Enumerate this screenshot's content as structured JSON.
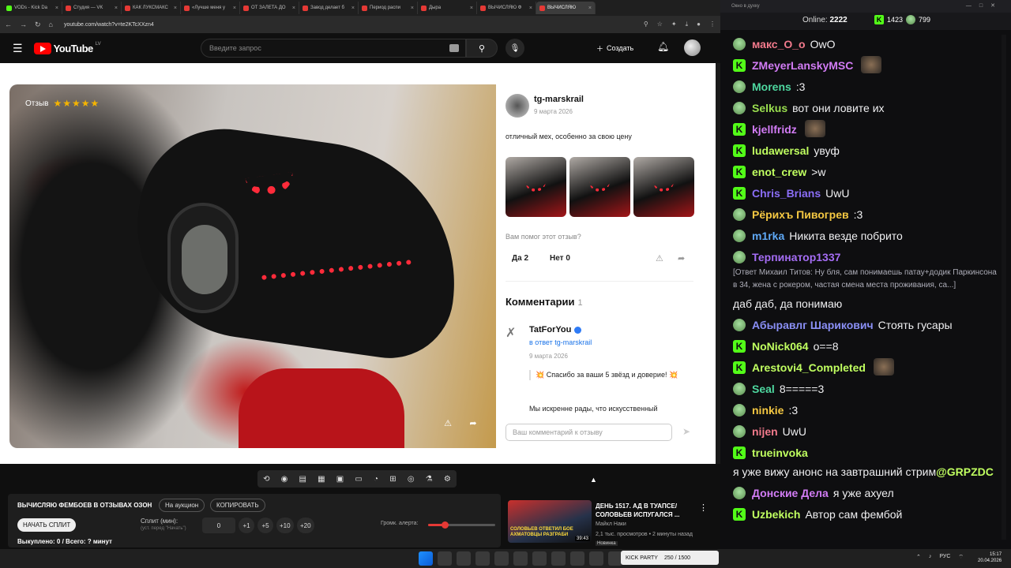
{
  "browser": {
    "tabs": [
      "VODs - Kick Da",
      "Студия — VK",
      "КАК ЛУКСМАКС",
      "«Лучше меня у",
      "ОТ ЗАЛЕТА ДО",
      "Завод делает б",
      "Период распи",
      "Дыра",
      "ВЫЧИСЛЯЮ Ф",
      "ВЫЧИСЛЯЮ"
    ],
    "url": "youtube.com/watch?v=te2KTcXXzn4",
    "window_controls": [
      "—",
      "□",
      "✕"
    ]
  },
  "youtube": {
    "logo_text": "YouTube",
    "country": "LV",
    "search_placeholder": "Введите запрос",
    "create_label": "Создать"
  },
  "review": {
    "badge_label": "Отзыв",
    "stars": "★★★★★",
    "author": "tg-marskrail",
    "date": "9 марта 2026",
    "text": "отличный мех, особенно за свою цену",
    "helpful_question": "Вам помог этот отзыв?",
    "yes_label": "Да 2",
    "no_label": "Нет 0",
    "comments_title": "Комментарии",
    "comments_count": "1",
    "comment": {
      "author": "TatForYou",
      "reply_to": "в ответ tg-marskrail",
      "date": "9 марта 2026",
      "line1": "💥 Спасибо за ваши 5 звёзд и доверие! 💥",
      "line2": "Мы искренне рады, что искусственный"
    },
    "comment_placeholder": "Ваш комментарий к отзыву"
  },
  "extension": {
    "title": "ВЫЧИСЛЯЮ ФЕМБОЕВ В ОТЗЫВАХ ОЗОН",
    "auction_label": "На аукцион",
    "copy_label": "КОПИРОВАТЬ",
    "start_label": "НАЧАТЬ СПЛИТ",
    "split_label": "Сплит (мин):",
    "split_hint": "(уст. перед \"Начать\")",
    "split_value": "0",
    "increments": [
      "+1",
      "+5",
      "+10",
      "+20"
    ],
    "volume_label": "Громк. алерта:",
    "volume_level": 0.25,
    "status": "Выкуплено: 0 / Всего: ? минут"
  },
  "suggested": {
    "thumb_text": "СОЛОВЬЕВ ОТВЕТИЛ БОЕ АХМАТОВЦЫ РАЗГРАБИ",
    "duration": "39:43",
    "title": "ДЕНЬ 1517. АД В ТУАПСЕ/ СОЛОВЬЕВ ИСПУГАЛСЯ ...",
    "channel": "Майкл Наки",
    "meta": "2,1 тыс. просмотров • 2 минуты назад",
    "badge": "Новинка"
  },
  "chat": {
    "window_title": "Окно в духку",
    "online_label": "Online:",
    "online_count": "2222",
    "kick_count": "1423",
    "pepe_count": "799",
    "messages": [
      {
        "user": "макс_O_o",
        "text": "OwO",
        "color": "#f27a8c",
        "badge": "p"
      },
      {
        "user": "ZMeyerLanskyMSC",
        "text": "",
        "color": "#d27cf5",
        "badge": "k"
      },
      {
        "user": "Morens",
        "text": ":3",
        "color": "#4ed8a0",
        "badge": "p"
      },
      {
        "user": "Selkus",
        "text": "вот они ловите их",
        "color": "#9adf4f",
        "badge": "p"
      },
      {
        "user": "kjellfridz",
        "text": "",
        "color": "#d27cf5",
        "badge": "k"
      },
      {
        "user": "ludawersal",
        "text": "увуф",
        "color": "#c0ff60",
        "badge": "k"
      },
      {
        "user": "enot_crew",
        "text": ">w",
        "color": "#c0ff60",
        "badge": "k"
      },
      {
        "user": "Chris_Brians",
        "text": "UwU",
        "color": "#8a6df5",
        "badge": "k"
      },
      {
        "user": "Рёрихъ Пивогрев",
        "text": ":3",
        "color": "#f5c842",
        "badge": "p"
      },
      {
        "user": "m1rka",
        "text": "Никита везде побрито",
        "color": "#5fa8f5",
        "badge": "p"
      },
      {
        "user": "Терпинатор1337",
        "text": "[Ответ Михаил Титов: Ну бля, сам понимаешь патау+додик Паркинсона в 34, жена с рокером, частая смена места проживания, са...]",
        "color": "#a56df5",
        "badge": "p"
      },
      {
        "user": "",
        "text": "даб даб, да понимаю",
        "color": "#ffffff",
        "badge": ""
      },
      {
        "user": "Абыравлг Шарикович",
        "text": "Стоять гусары",
        "color": "#8a8ff5",
        "badge": "p"
      },
      {
        "user": "NoNick064",
        "text": "o==8",
        "color": "#c0ff60",
        "badge": "k"
      },
      {
        "user": "Arestovi4_Completed",
        "text": "",
        "color": "#c0ff60",
        "badge": "k"
      },
      {
        "user": "Seal",
        "text": "8=====3",
        "color": "#4ed8a0",
        "badge": "p"
      },
      {
        "user": "ninkie",
        "text": ":3",
        "color": "#f5c842",
        "badge": "p"
      },
      {
        "user": "nijen",
        "text": "UwU",
        "color": "#f27a8c",
        "badge": "p"
      },
      {
        "user": "trueinvoka",
        "text": "я уже вижу анонс на завтрашний стрим",
        "color": "#c0ff60",
        "badge": "k"
      },
      {
        "user": "Донские Дела",
        "text": "я уже ахуел",
        "color": "#d27cf5",
        "badge": "p"
      },
      {
        "user": "Uzbekich",
        "text": "Автор сам фембой",
        "color": "#c0ff60",
        "badge": "k"
      }
    ],
    "mention": "@GRPZDC"
  },
  "taskbar": {
    "kick_widget": "KICK PARTY",
    "kick_progress": "250 / 1500",
    "lang": "РУС",
    "time": "15:17",
    "date": "20.04.2026"
  }
}
